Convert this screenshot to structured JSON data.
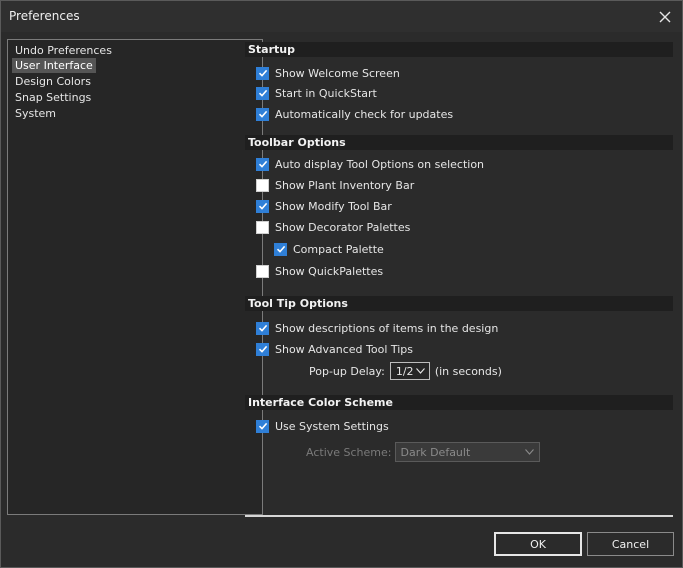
{
  "window": {
    "title": "Preferences"
  },
  "sidebar": {
    "items": [
      {
        "label": "Undo Preferences",
        "selected": false
      },
      {
        "label": "User Interface",
        "selected": true
      },
      {
        "label": "Design Colors",
        "selected": false
      },
      {
        "label": "Snap Settings",
        "selected": false
      },
      {
        "label": "System",
        "selected": false
      }
    ]
  },
  "startup": {
    "header": "Startup",
    "show_welcome": {
      "label": "Show Welcome Screen",
      "checked": true
    },
    "quickstart": {
      "label": "Start in QuickStart",
      "checked": true
    },
    "check_updates": {
      "label": "Automatically check for updates",
      "checked": true
    }
  },
  "toolbar": {
    "header": "Toolbar Options",
    "auto_display": {
      "label": "Auto display Tool Options on selection",
      "checked": true
    },
    "plant_inventory": {
      "label": "Show Plant Inventory Bar",
      "checked": false
    },
    "modify_toolbar": {
      "label": "Show Modify Tool Bar",
      "checked": true
    },
    "decorator_palettes": {
      "label": "Show Decorator Palettes",
      "checked": false
    },
    "compact_palette": {
      "label": "Compact Palette",
      "checked": true
    },
    "quickpalettes": {
      "label": "Show QuickPalettes",
      "checked": false
    }
  },
  "tooltips": {
    "header": "Tool Tip Options",
    "descriptions": {
      "label": "Show descriptions of items in the design",
      "checked": true
    },
    "advanced": {
      "label": "Show Advanced Tool Tips",
      "checked": true
    },
    "delay_label": "Pop-up Delay:",
    "delay_value": "1/2",
    "delay_unit": "(in seconds)"
  },
  "color_scheme": {
    "header": "Interface Color Scheme",
    "use_system": {
      "label": "Use System Settings",
      "checked": true
    },
    "active_label": "Active Scheme:",
    "active_value": "Dark Default"
  },
  "buttons": {
    "ok": "OK",
    "cancel": "Cancel"
  },
  "colors": {
    "accent": "#2f7fd7",
    "background": "#2b2b2b"
  }
}
